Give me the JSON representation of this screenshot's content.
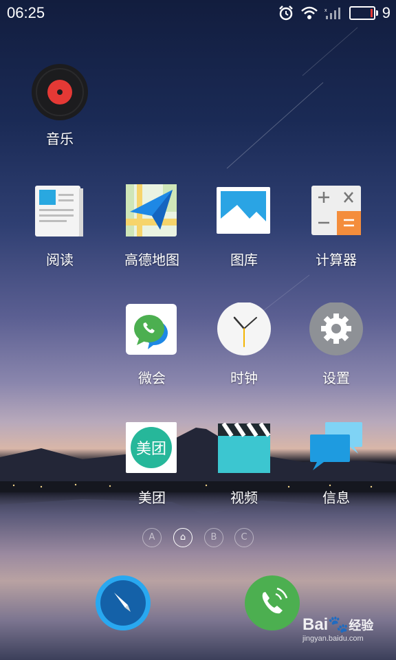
{
  "status_bar": {
    "time": "06:25",
    "battery_level": "9",
    "battery_fraction": 0.09
  },
  "apps": {
    "music": "音乐",
    "reading": "阅读",
    "amap": "高德地图",
    "gallery": "图库",
    "calculator": "计算器",
    "weihui": "微会",
    "clock": "时钟",
    "settings": "设置",
    "meituan": "美团",
    "video": "视频",
    "messages": "信息"
  },
  "meituan_icon_text": "美团",
  "page_indicators": [
    "A",
    "⌂",
    "B",
    "C"
  ],
  "active_page": 1,
  "watermark": {
    "brand": "Bai",
    "brand2": "经验",
    "url": "jingyan.baidu.com"
  },
  "colors": {
    "phone_green": "#4caf50",
    "browser_blue": "#1e88e5",
    "music_red": "#e53935"
  }
}
